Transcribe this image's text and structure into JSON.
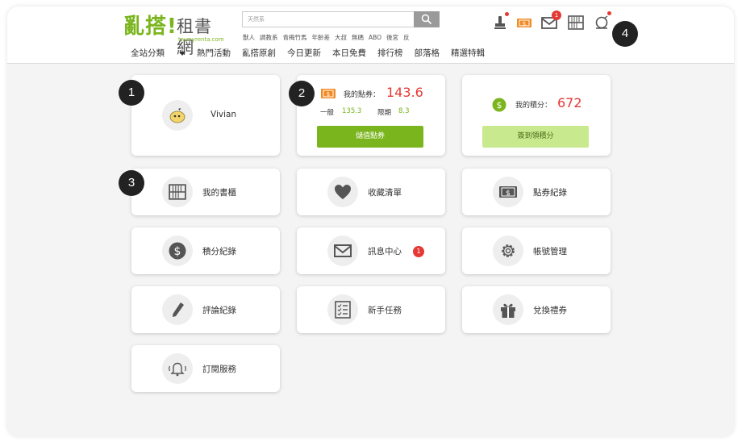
{
  "logo": {
    "main": "亂搭!",
    "cn": "租書網",
    "url": "tw.myrenta.com"
  },
  "search": {
    "placeholder": "天然系",
    "hot_words": [
      "獸人",
      "調教系",
      "青梅竹馬",
      "年齡差",
      "大叔",
      "無碼",
      "ABO",
      "後宮",
      "反"
    ]
  },
  "nav": {
    "items": [
      "全站分類",
      "熱門活動",
      "亂搭原創",
      "今日更新",
      "本日免費",
      "排行榜",
      "部落格",
      "精選特輯"
    ]
  },
  "header_icons": {
    "mail_badge": "1"
  },
  "user": {
    "name": "Vivian"
  },
  "points": {
    "label": "我的點券：",
    "value": "143.6",
    "general_label": "一般",
    "general_value": "135.3",
    "limited_label": "限期",
    "limited_value": "8.3",
    "button": "儲值點券"
  },
  "score": {
    "label": "我的積分：",
    "value": "672",
    "button": "簽到領積分"
  },
  "menu": [
    {
      "label": "我的書櫃",
      "icon": "bookshelf-icon"
    },
    {
      "label": "收藏清單",
      "icon": "heart-icon"
    },
    {
      "label": "點券紀錄",
      "icon": "ticket-icon"
    },
    {
      "label": "積分紀錄",
      "icon": "dollar-icon"
    },
    {
      "label": "訊息中心",
      "icon": "mail-icon",
      "badge": "1"
    },
    {
      "label": "帳號管理",
      "icon": "gear-icon"
    },
    {
      "label": "評論紀錄",
      "icon": "pen-icon"
    },
    {
      "label": "新手任務",
      "icon": "checklist-icon"
    },
    {
      "label": "兌換禮券",
      "icon": "gift-icon"
    },
    {
      "label": "訂閱服務",
      "icon": "bell-icon"
    }
  ],
  "markers": [
    "1",
    "2",
    "3",
    "4"
  ],
  "colors": {
    "brand_green": "#7ab51d",
    "price_red": "#e53935",
    "badge_orange": "#f08a24"
  }
}
